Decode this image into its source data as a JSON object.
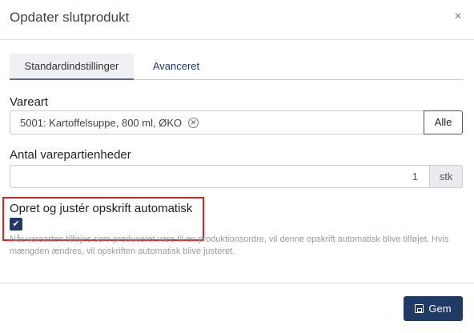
{
  "dialog": {
    "title": "Opdater slutprodukt",
    "close_glyph": "×"
  },
  "tabs": [
    {
      "label": "Standardindstillinger",
      "active": true
    },
    {
      "label": "Avanceret",
      "active": false
    }
  ],
  "item_field": {
    "label": "Vareart",
    "value": "5001: Kartoffelsuppe, 800 ml, ØKO",
    "clear_glyph": "⊗",
    "button_label": "Alle"
  },
  "quantity_field": {
    "label": "Antal varepartienheder",
    "value": "1",
    "unit": "stk"
  },
  "auto_recipe": {
    "label": "Opret og justér opskrift automatisk",
    "checked": true,
    "check_glyph": "✔",
    "help_text": "Når varearten tilføjes som produceret vare til en produktionsordre, vil denne opskrift automatisk blive tilføjet. Hvis mængden ændres, vil opskriften automatisk blive justeret."
  },
  "footer": {
    "save_label": "Gem"
  },
  "colors": {
    "primary": "#1f3a64",
    "highlight": "#d4252b"
  }
}
